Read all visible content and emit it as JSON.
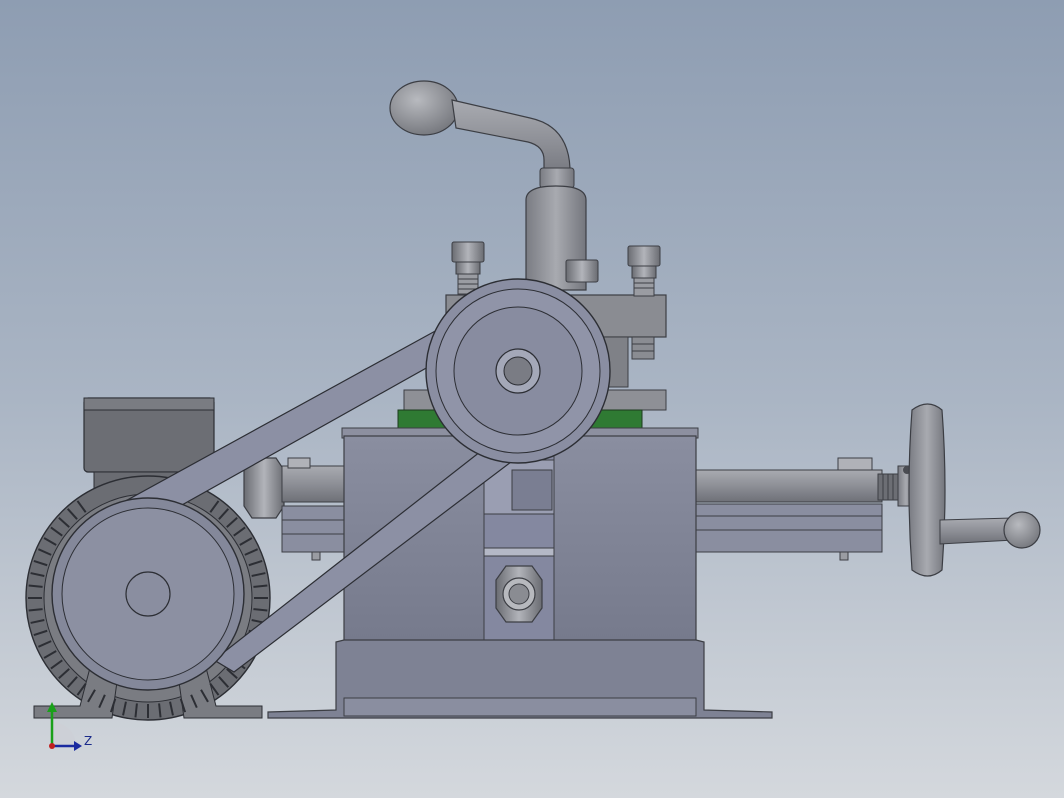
{
  "viewport": {
    "background_top": "#8e9db2",
    "background_bottom": "#d4d8dd"
  },
  "triad": {
    "axes": [
      "Y",
      "Z"
    ],
    "y_color": "#1aa01a",
    "z_color": "#1a2aa0",
    "z_label": "Z"
  },
  "model": {
    "parts": [
      "motor",
      "motor-pulley",
      "drive-belt",
      "driven-pulley",
      "handle-lever",
      "tool-post",
      "clamp-bolts",
      "base-housing",
      "feed-screw",
      "handwheel",
      "base-plate"
    ],
    "colors": {
      "steel": "#8c8e94",
      "housing": "#7c8092",
      "dark_steel": "#6c6e74",
      "accent_green": "#2f7a33"
    }
  }
}
